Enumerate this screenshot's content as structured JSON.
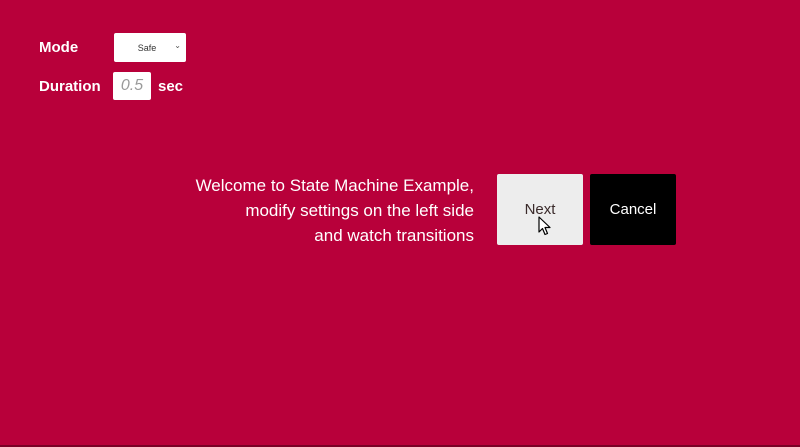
{
  "settings": {
    "mode": {
      "label": "Mode",
      "selected": "Safe"
    },
    "duration": {
      "label": "Duration",
      "placeholder": "0.5",
      "unit": "sec"
    }
  },
  "welcome": {
    "lines": [
      "Welcome to State Machine Example,",
      "modify settings on the left side",
      "and watch transitions"
    ]
  },
  "buttons": {
    "next": "Next",
    "cancel": "Cancel"
  },
  "colors": {
    "background": "#b8003a",
    "next_button": "#ededed",
    "cancel_button": "#000000"
  },
  "icons": {
    "caret": "chevron-down-icon",
    "cursor": "mouse-pointer-icon"
  }
}
